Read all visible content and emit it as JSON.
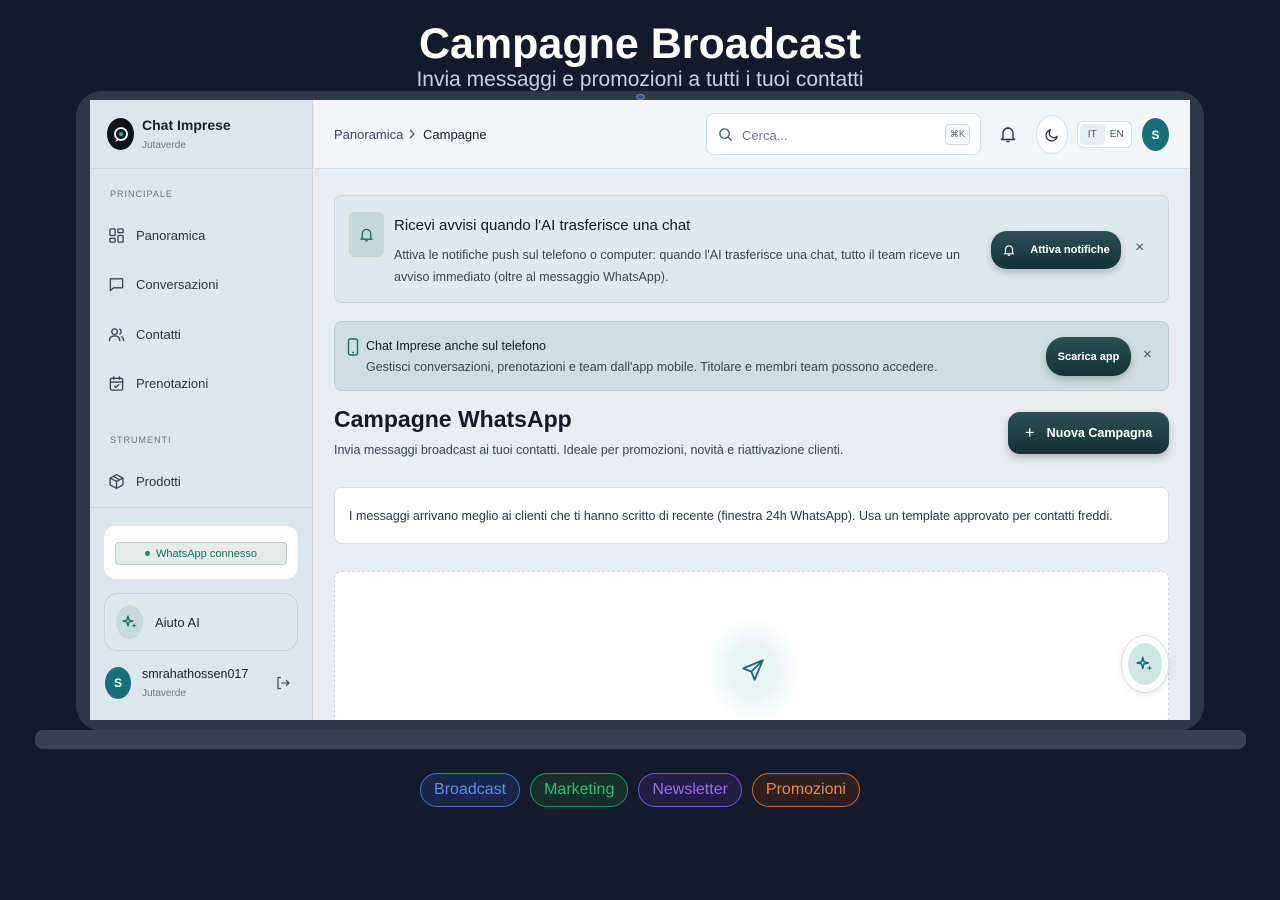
{
  "hero": {
    "title": "Campagne Broadcast",
    "subtitle": "Invia messaggi e promozioni a tutti i tuoi contatti"
  },
  "sidebar": {
    "brand_name": "Chat Imprese",
    "brand_sub": "Jutaverde",
    "section_main": "PRINCIPALE",
    "section_tools": "STRUMENTI",
    "items": [
      {
        "label": "Panoramica",
        "icon": "grid-icon"
      },
      {
        "label": "Conversazioni",
        "icon": "chat-bubble-icon"
      },
      {
        "label": "Contatti",
        "icon": "users-icon"
      },
      {
        "label": "Prenotazioni",
        "icon": "calendar-check-icon"
      }
    ],
    "tools": [
      {
        "label": "Prodotti",
        "icon": "box-icon"
      }
    ],
    "whatsapp_status": "WhatsApp connesso",
    "ai_help": "Aiuto AI",
    "user_name": "smrahathossen017",
    "user_org": "Jutaverde",
    "user_initial": "S"
  },
  "topbar": {
    "breadcrumb": [
      "Panoramica",
      "Campagne"
    ],
    "search_placeholder": "Cerca...",
    "search_shortcut": "⌘K",
    "lang_options": [
      "IT",
      "EN"
    ],
    "lang_selected": "IT",
    "avatar_initial": "S"
  },
  "notif_banner": {
    "title": "Ricevi avvisi quando l'AI trasferisce una chat",
    "text": "Attiva le notifiche push sul telefono o computer: quando l'AI trasferisce una chat, tutto il team riceve un avviso immediato (oltre al messaggio WhatsApp).",
    "button": "Attiva notifiche",
    "close": "×"
  },
  "app_banner": {
    "title": "Chat Imprese anche sul telefono",
    "text": "Gestisci conversazioni, prenotazioni e team dall'app mobile. Titolare e membri team possono accedere.",
    "button": "Scarica app",
    "close": "×"
  },
  "main": {
    "title": "Campagne WhatsApp",
    "subtitle": "Invia messaggi broadcast ai tuoi contatti. Ideale per promozioni, novità e riattivazione clienti.",
    "new_button": "Nuova Campagna",
    "new_button_icon": "+",
    "info": "I messaggi arrivano meglio ai clienti che ti hanno scritto di recente (finestra 24h WhatsApp). Usa un template approvato per contatti freddi."
  },
  "tags": [
    {
      "label": "Broadcast",
      "color": "#5b8ef0"
    },
    {
      "label": "Marketing",
      "color": "#2fc078"
    },
    {
      "label": "Newsletter",
      "color": "#9a70f0"
    },
    {
      "label": "Promozioni",
      "color": "#f08a40"
    }
  ],
  "colors": {
    "background": "#121a2b",
    "accent": "#14707a",
    "button_dark": "#123238"
  }
}
